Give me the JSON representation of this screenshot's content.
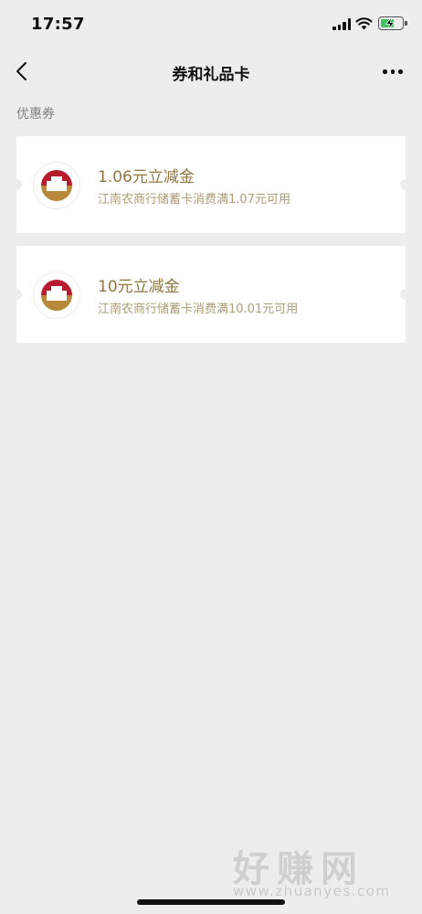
{
  "status_bar": {
    "time": "17:57"
  },
  "nav": {
    "title": "券和礼品卡"
  },
  "section": {
    "title": "优惠券"
  },
  "coupons": [
    {
      "title": "1.06元立减金",
      "subtitle": "江南农商行储蓄卡消费满1.07元可用"
    },
    {
      "title": "10元立减金",
      "subtitle": "江南农商行储蓄卡消费满10.01元可用"
    }
  ],
  "icons": {
    "back": "back-arrow-icon",
    "more": "more-dots-icon",
    "signal": "cellular-signal-icon",
    "wifi": "wifi-icon",
    "battery": "battery-charging-icon",
    "bank_logo": "bank-logo-icon"
  },
  "colors": {
    "background": "#ededed",
    "card": "#ffffff",
    "coupon_title": "#8f7540",
    "coupon_subtitle": "#ad9c75",
    "logo_red": "#b51c2d",
    "logo_gold": "#b8893a",
    "battery_green": "#3cc15b"
  },
  "watermark": {
    "text": "好赚网",
    "url": "www.zhuanyes.com"
  }
}
